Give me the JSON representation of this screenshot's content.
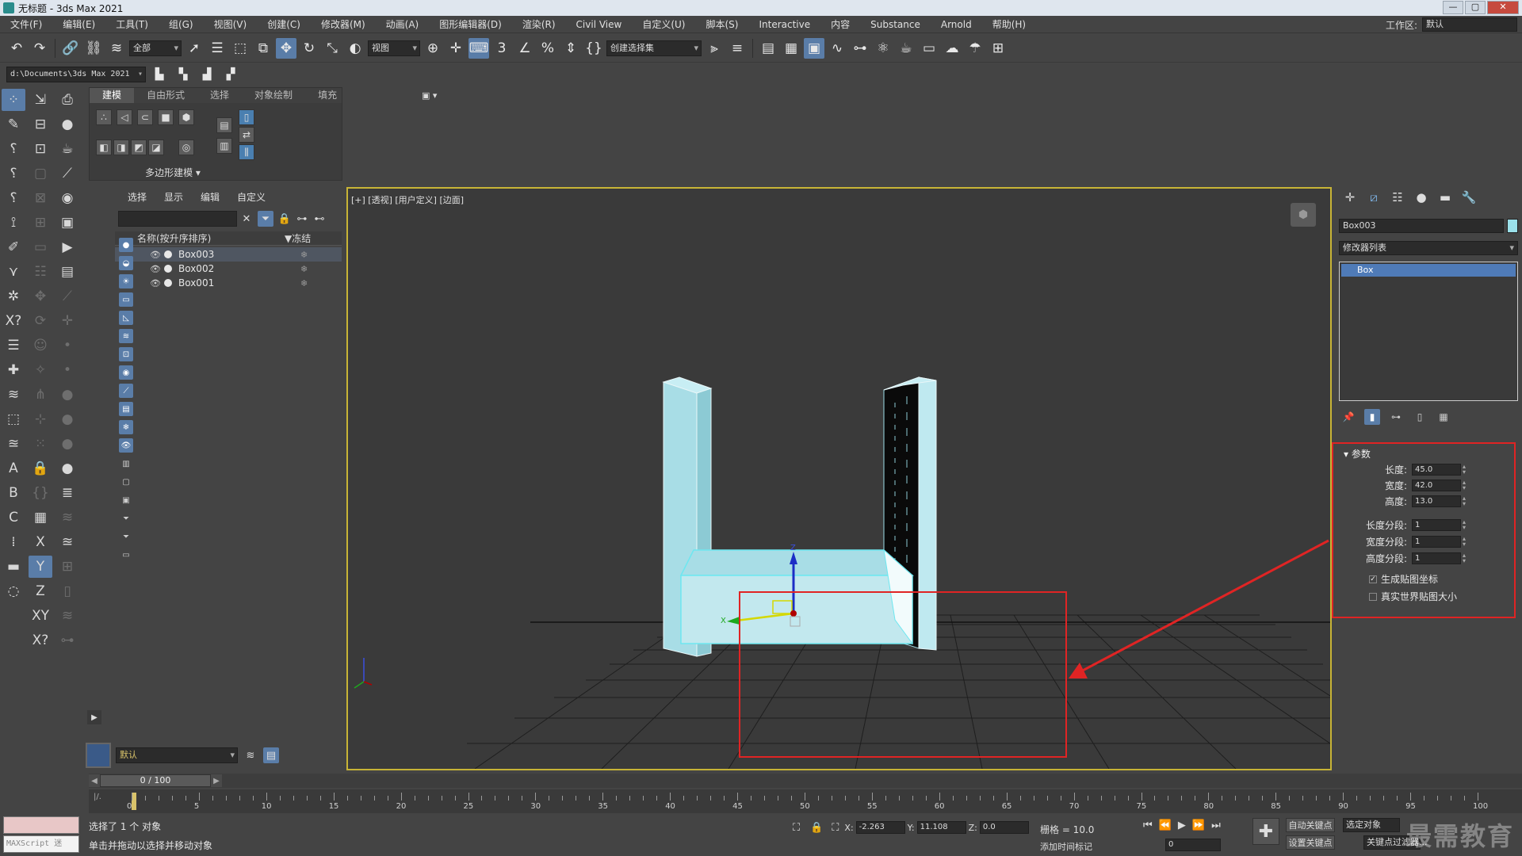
{
  "window": {
    "title": "无标题 - 3ds Max 2021",
    "minimize": "—",
    "maximize": "▢",
    "close": "✕"
  },
  "menu": [
    "文件(F)",
    "编辑(E)",
    "工具(T)",
    "组(G)",
    "视图(V)",
    "创建(C)",
    "修改器(M)",
    "动画(A)",
    "图形编辑器(D)",
    "渲染(R)",
    "Civil View",
    "自定义(U)",
    "脚本(S)",
    "Interactive",
    "内容",
    "Substance",
    "Arnold",
    "帮助(H)"
  ],
  "workspace": {
    "label": "工作区:",
    "value": "默认"
  },
  "toolbar": {
    "selection_filter": "全部",
    "ref_coord": "视图",
    "named_selection": "创建选择集"
  },
  "project": {
    "path": "d:\\Documents\\3ds Max 2021"
  },
  "ribbon": {
    "tabs": [
      "建模",
      "自由形式",
      "选择",
      "对象绘制",
      "填充"
    ],
    "active_tab": "建模",
    "panel_title": "多边形建模 ▾",
    "extra": "▣ ▾"
  },
  "explorer": {
    "tabs": [
      "选择",
      "显示",
      "编辑",
      "自定义"
    ],
    "col_name": "名称(按升序排序)",
    "col_freeze": "▼冻结",
    "rows": [
      {
        "name": "Box003",
        "selected": true
      },
      {
        "name": "Box002",
        "selected": false
      },
      {
        "name": "Box001",
        "selected": false
      }
    ],
    "layer": "默认"
  },
  "viewport": {
    "label": "[+] [透视] [用户定义] [边面]",
    "gizmo_icon": "cube-icon"
  },
  "command_panel": {
    "object_name": "Box003",
    "modifier_list": "修改器列表",
    "stack_item": "Box",
    "params_title": "▾ 参数",
    "params": [
      {
        "label": "长度:",
        "value": "45.0"
      },
      {
        "label": "宽度:",
        "value": "42.0"
      },
      {
        "label": "高度:",
        "value": "13.0"
      },
      {
        "label": "长度分段:",
        "value": "1"
      },
      {
        "label": "宽度分段:",
        "value": "1"
      },
      {
        "label": "高度分段:",
        "value": "1"
      }
    ],
    "gen_mapping": "生成贴图坐标",
    "real_world": "真实世界贴图大小",
    "gen_mapping_checked": true,
    "real_world_checked": false
  },
  "timeline": {
    "slider": "0 / 100",
    "ticks": [
      0,
      5,
      10,
      15,
      20,
      25,
      30,
      35,
      40,
      45,
      50,
      55,
      60,
      65,
      70,
      75,
      80,
      85,
      90,
      95,
      100
    ]
  },
  "status": {
    "maxscript": "MAXScript 迷",
    "selection": "选择了 1 个 对象",
    "prompt": "单击并拖动以选择并移动对象",
    "x_label": "X:",
    "x": "-2.263",
    "y_label": "Y:",
    "y": "11.108",
    "z_label": "Z:",
    "z": "0.0",
    "grid": "栅格 = 10.0",
    "add_time_tag": "添加时间标记",
    "frame": "0",
    "auto_key": "自动关键点",
    "set_key": "设置关键点",
    "selected_object": "选定对象",
    "key_filter": "关键点过滤器...",
    "watermark": "最需教育"
  }
}
